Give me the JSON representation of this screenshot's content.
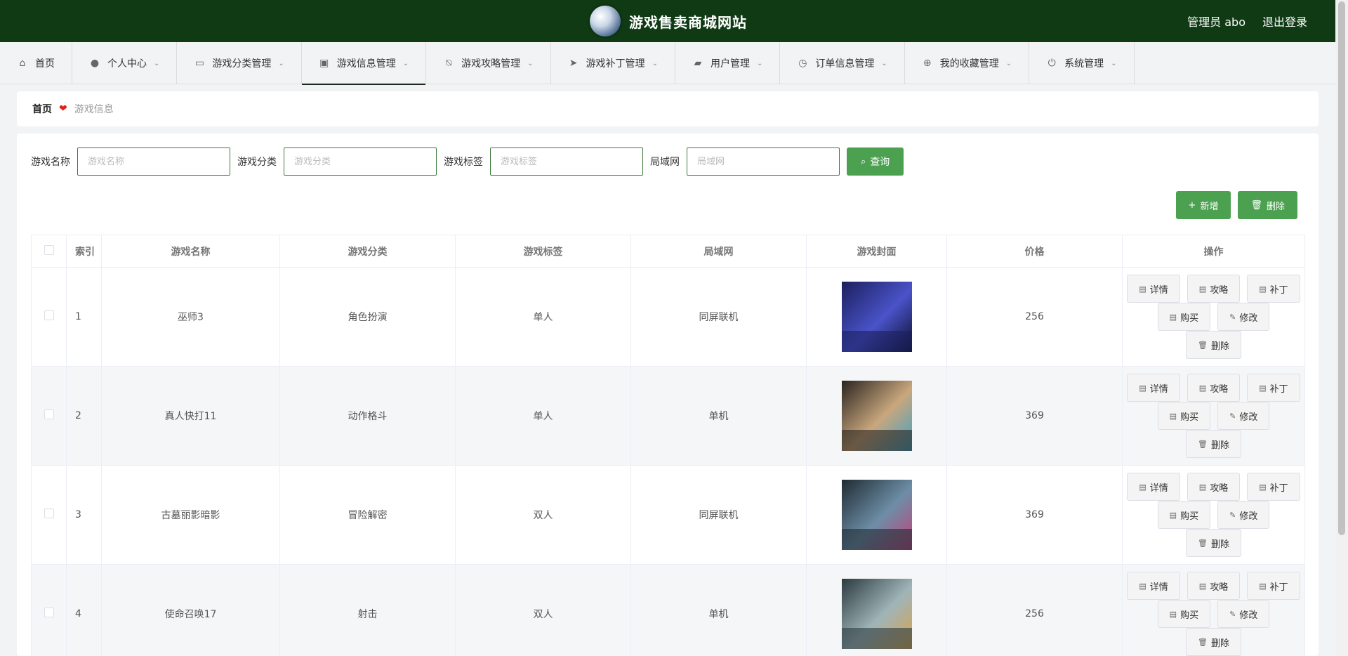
{
  "header": {
    "site_title": "游戏售卖商城网站",
    "admin_label": "管理员 abo",
    "logout_label": "退出登录"
  },
  "nav": {
    "items": [
      {
        "label": "首页",
        "icon": "home-icon"
      },
      {
        "label": "个人中心",
        "icon": "user-icon"
      },
      {
        "label": "游戏分类管理",
        "icon": "message-icon"
      },
      {
        "label": "游戏信息管理",
        "icon": "chart-icon"
      },
      {
        "label": "游戏攻略管理",
        "icon": "bell-off-icon"
      },
      {
        "label": "游戏补丁管理",
        "icon": "send-icon"
      },
      {
        "label": "用户管理",
        "icon": "briefcase-icon"
      },
      {
        "label": "订单信息管理",
        "icon": "clock-icon"
      },
      {
        "label": "我的收藏管理",
        "icon": "help-icon"
      },
      {
        "label": "系统管理",
        "icon": "power-icon"
      }
    ]
  },
  "breadcrumb": {
    "home": "首页",
    "current": "游戏信息"
  },
  "search": {
    "name_label": "游戏名称",
    "name_placeholder": "游戏名称",
    "category_label": "游戏分类",
    "category_placeholder": "游戏分类",
    "tag_label": "游戏标签",
    "tag_placeholder": "游戏标签",
    "lan_label": "局域网",
    "lan_placeholder": "局域网",
    "query_button": "查询"
  },
  "actions": {
    "add_button": "新增",
    "delete_button": "删除"
  },
  "table": {
    "columns": [
      "索引",
      "游戏名称",
      "游戏分类",
      "游戏标签",
      "局域网",
      "游戏封面",
      "价格",
      "操作"
    ],
    "op_labels": {
      "detail": "详情",
      "guide": "攻略",
      "patch": "补丁",
      "buy": "购买",
      "edit": "修改",
      "delete": "删除"
    },
    "rows": [
      {
        "index": "1",
        "name": "巫师3",
        "category": "角色扮演",
        "tag": "单人",
        "lan": "同屏联机",
        "price": "256",
        "cover_colors": [
          "#1b1f5e",
          "#4a53c9",
          "#0c0f2a"
        ]
      },
      {
        "index": "2",
        "name": "真人快打11",
        "category": "动作格斗",
        "tag": "单人",
        "lan": "单机",
        "price": "369",
        "cover_colors": [
          "#2a2420",
          "#c9a77d",
          "#3ea0c4"
        ]
      },
      {
        "index": "3",
        "name": "古墓丽影暗影",
        "category": "冒险解密",
        "tag": "双人",
        "lan": "同屏联机",
        "price": "369",
        "cover_colors": [
          "#1f2b33",
          "#6d8ea6",
          "#c43f7a"
        ]
      },
      {
        "index": "4",
        "name": "使命召唤17",
        "category": "射击",
        "tag": "双人",
        "lan": "单机",
        "price": "256",
        "cover_colors": [
          "#2b3a3f",
          "#9fb5b8",
          "#d9a24a"
        ]
      }
    ]
  }
}
